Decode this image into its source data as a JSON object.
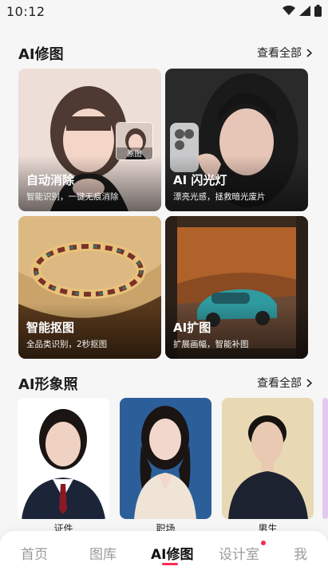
{
  "status": {
    "time": "10:12"
  },
  "retouch": {
    "title": "AI修图",
    "see_all": "查看全部",
    "cards": [
      {
        "title": "自动消除",
        "subtitle": "智能识别，一键无痕消除",
        "badge": "原图"
      },
      {
        "title": "AI 闪光灯",
        "subtitle": "漂亮光感，拯救暗光废片"
      },
      {
        "title": "智能抠图",
        "subtitle": "全品类识别，2秒抠图"
      },
      {
        "title": "AI扩图",
        "subtitle": "扩展画幅，智能补图"
      }
    ]
  },
  "portrait": {
    "title": "AI形象照",
    "see_all": "查看全部",
    "items": [
      {
        "label": "证件"
      },
      {
        "label": "职场"
      },
      {
        "label": "男生"
      }
    ]
  },
  "nav": {
    "items": [
      {
        "label": "首页"
      },
      {
        "label": "图库"
      },
      {
        "label": "AI修图"
      },
      {
        "label": "设计室"
      },
      {
        "label": "我"
      }
    ],
    "active_index": 2,
    "accent_color": "#ff2a55"
  }
}
